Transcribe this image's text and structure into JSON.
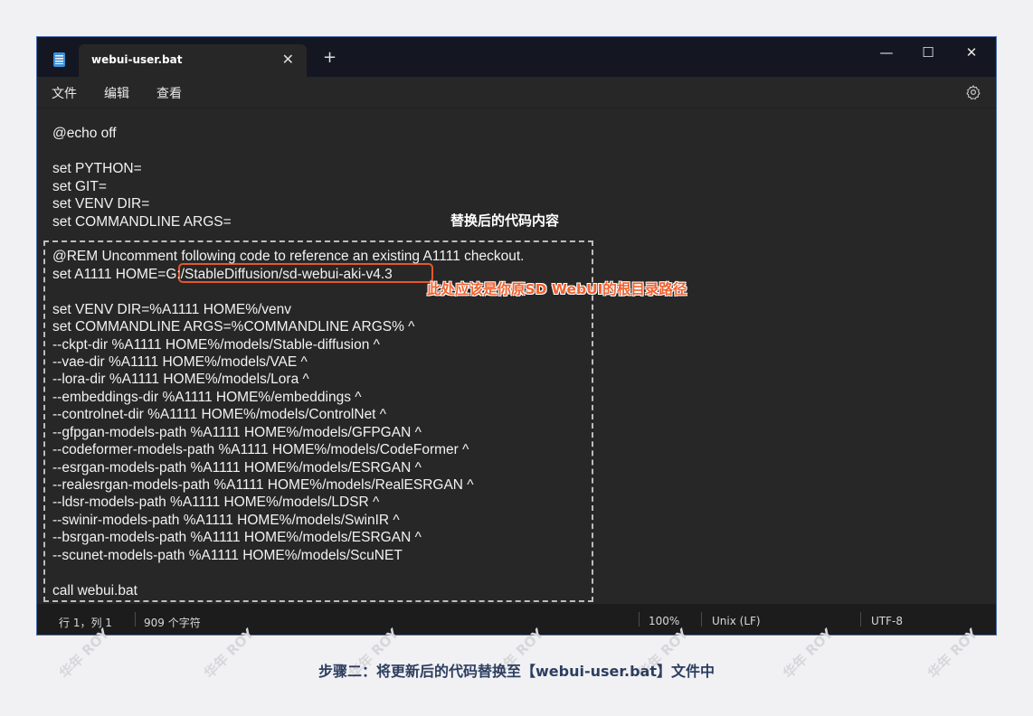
{
  "window": {
    "tab_title": "webui-user.bat",
    "tab_close": "✕",
    "tab_add": "+",
    "minimize": "—",
    "maximize": "☐",
    "close": "✕"
  },
  "menu": {
    "file": "文件",
    "edit": "编辑",
    "view": "查看"
  },
  "editor": {
    "lines": [
      "@echo off",
      "",
      "set PYTHON=",
      "set GIT=",
      "set VENV DIR=",
      "set COMMANDLINE ARGS=",
      "",
      "@REM Uncomment following code to reference an existing A1111 checkout.",
      "set A1111 HOME=G:/StableDiffusion/sd-webui-aki-v4.3",
      "",
      "set VENV DIR=%A1111 HOME%/venv",
      "set COMMANDLINE ARGS=%COMMANDLINE ARGS% ^",
      "--ckpt-dir %A1111 HOME%/models/Stable-diffusion ^",
      "--vae-dir %A1111 HOME%/models/VAE ^",
      "--lora-dir %A1111 HOME%/models/Lora ^",
      "--embeddings-dir %A1111 HOME%/embeddings ^",
      "--controlnet-dir %A1111 HOME%/models/ControlNet ^",
      "--gfpgan-models-path %A1111 HOME%/models/GFPGAN ^",
      "--codeformer-models-path %A1111 HOME%/models/CodeFormer ^",
      "--esrgan-models-path %A1111 HOME%/models/ESRGAN ^",
      "--realesrgan-models-path %A1111 HOME%/models/RealESRGAN ^",
      "--ldsr-models-path %A1111 HOME%/models/LDSR ^",
      "--swinir-models-path %A1111 HOME%/models/SwinIR ^",
      "--bsrgan-models-path %A1111 HOME%/models/ESRGAN ^",
      "--scunet-models-path %A1111 HOME%/models/ScuNET",
      "",
      "call webui.bat"
    ]
  },
  "annotations": {
    "replaced_content": "替换后的代码内容",
    "path_note": "此处应该是你原SD WebUI的根目录路径"
  },
  "status": {
    "position": "行 1，列 1",
    "char_count": "909 个字符",
    "zoom": "100%",
    "line_ending": "Unix (LF)",
    "encoding": "UTF-8"
  },
  "caption": "步骤二：将更新后的代码替换至【webui-user.bat】文件中",
  "watermark": "华年 ROY",
  "colors": {
    "annotation_orange": "#f0622f",
    "caption": "#2c3e60",
    "window_border": "#4a6ea9"
  }
}
